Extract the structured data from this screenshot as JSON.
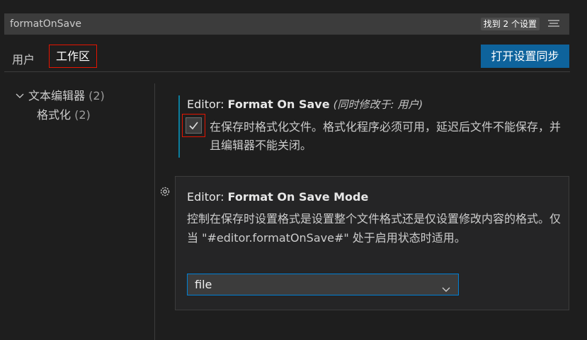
{
  "search": {
    "value": "formatOnSave",
    "result_badge": "找到 2 个设置"
  },
  "tabs": {
    "user_label": "用户",
    "workspace_label": "工作区",
    "active": "workspace"
  },
  "sync_button_label": "打开设置同步",
  "tree": {
    "items": [
      {
        "label": "文本编辑器",
        "count": "(2)",
        "expanded": true
      },
      {
        "label": "格式化",
        "count": "(2)"
      }
    ]
  },
  "setting1": {
    "category": "Editor: ",
    "name": "Format On Save",
    "modified_note": "(同时修改于: 用户)",
    "checked": true,
    "description": "在保存时格式化文件。格式化程序必须可用，延迟后文件不能保存，并且编辑器不能关闭。"
  },
  "setting2": {
    "category": "Editor: ",
    "name": "Format On Save Mode",
    "description": "控制在保存时设置格式是设置整个文件格式还是仅设置修改内容的格式。仅当 \"#editor.formatOnSave#\" 处于启用状态时适用。",
    "dropdown_value": "file"
  },
  "colors": {
    "accent": "#0e639c",
    "focus_border": "#007fd4",
    "highlight_box": "#e51400",
    "modified_bar": "#0c7d9d"
  },
  "icons": {
    "filter": "filter-lines-icon",
    "chevron": "chevron-down-icon",
    "gear": "gear-icon",
    "check": "check-icon"
  }
}
